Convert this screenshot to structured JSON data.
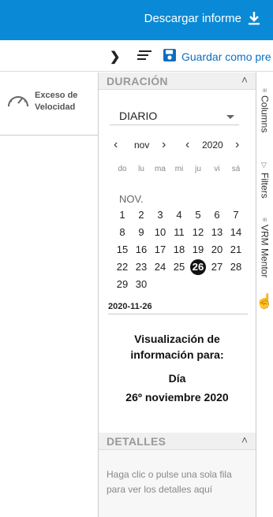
{
  "header": {
    "download_label": "Descargar informe"
  },
  "toolbar": {
    "save_label": "Guardar como pre"
  },
  "left": {
    "speed_line1": "Exceso de",
    "speed_line2": "Velocidad"
  },
  "duration": {
    "title": "DURACIÓN",
    "period": "DIARIO",
    "month": "nov",
    "year": "2020",
    "weekdays": [
      "do",
      "lu",
      "ma",
      "mi",
      "ju",
      "vi",
      "sá"
    ],
    "month_label": "NOV.",
    "days": [
      "1",
      "2",
      "3",
      "4",
      "5",
      "6",
      "7",
      "8",
      "9",
      "10",
      "11",
      "12",
      "13",
      "14",
      "15",
      "16",
      "17",
      "18",
      "19",
      "20",
      "21",
      "22",
      "23",
      "24",
      "25",
      "26",
      "27",
      "28",
      "29",
      "30"
    ],
    "selected_day": "26",
    "date_value": "2020-11-26",
    "info_line1": "Visualización de",
    "info_line2": "información para:",
    "info_type": "Día",
    "info_date": "26º noviembre 2020"
  },
  "details": {
    "title": "DETALLES",
    "text": "Haga clic o pulse una sola fila para ver los detalles aquí"
  },
  "side_tabs": {
    "columns": "Columns",
    "filters": "Filters",
    "mentor": "VRM Mentor"
  },
  "colors": {
    "header_bg": "#0a8ad6",
    "save_blue": "#0a6fc2",
    "selected_day": "#111111"
  }
}
